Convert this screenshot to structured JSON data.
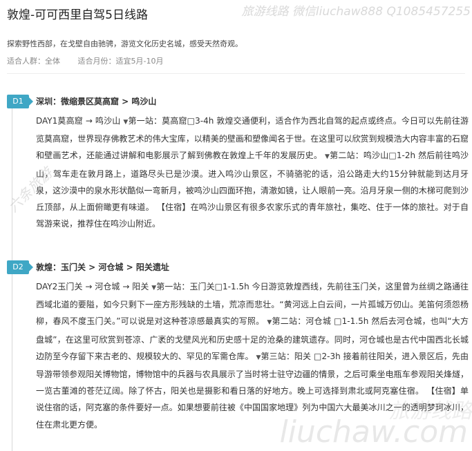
{
  "watermark": {
    "top": "旅游线路 微信liuchaw888 Q1085457255",
    "diagonal": "六条旅游",
    "bottom": "liuchaw.com",
    "bottom_cn": "旅游线路"
  },
  "page": {
    "title": "敦煌-可可西里自驾5日线路",
    "description": "探索野性西部，在戈壁自由驰骋，游览文化历史名城，感受天然奇观。",
    "meta": {
      "crowd": "适合人群：全体",
      "month": "适合月份：适宜5月-10月"
    }
  },
  "days": [
    {
      "badge": "D1",
      "heading": "深圳：微缩景区莫高窟 > 鸣沙山",
      "route": "DAY1莫高窟 → 鸣沙山",
      "stops": [
        "第一站：莫高窟□3-4h 敦煌交通便利，适合作为西北自驾的起点或终点。今日可以先前往游览莫高窟，世界现存佛教艺术的伟大宝库，以精美的壁画和塑像闻名于世。在这里可以欣赏到规模浩大内容丰富的石窟和壁画艺术，还能通过讲解和电影展示了解到佛教在敦煌上千年的发展历史。",
        "第二站：鸣沙山□1-2h 然后前往鸣沙山，驾车走在敦月路上，道路尽头已是沙漠。进入鸣沙山景区，不骑骆驼的话，沿公路走大约15分钟就能到达月牙泉，这沙漠中的泉水形状酷似一弯新月，被鸣沙山四面环抱，清澈如镜，让人眼前一亮。沿月牙泉一侧的木梯可爬到沙丘顶部，从上面俯瞰更有味道。"
      ],
      "stay": "【住宿】在鸣沙山景区有很多农家乐式的青年旅社，集吃、住于一体的旅社。对于自驾游来说，推荐住在鸣沙山附近。"
    },
    {
      "badge": "D2",
      "heading": "敦煌：玉门关 > 河仓城 > 阳关遗址",
      "route": "DAY2玉门关 → 河仓城 → 阳关",
      "stops": [
        "第一站：玉门关□1-1.5h 今日游览敦煌西线，先前往玉门关，这里曾为丝绸之路通往西域北道的要隘，如今只剩下一座方形残缺的土墙，荒凉而悲壮。“黄河远上白云间，一片孤城万仞山。羌笛何须怨杨柳，春风不度玉门关。”可以说是对这种苍凉感最真实的写照。",
        "第二站：河仓城 □1-1.5h 然后去河仓城，也叫“大方盘城”，在这里可欣赏到苍凉、广袤的戈壁风光和历史感十足的沧桑的建筑遗存。同时，河仓城也是古代中国西北长城边防至今存留下来古老的、规模较大的、罕见的军需仓库。",
        "第三站：阳关 □2-3h 接着前往阳关，进入景区后，先由导游带领参观阳关博物馆，博物馆中的兵器与农具展示了当时将士驻守边疆的情景，之后可乘坐电瓶车参观阳关烽燧，一览古董滩的苍茫辽阔。除了怀古，阳关也是摄影和看日落的好地方。晚上可选择到肃北或阿克塞住宿。"
      ],
      "stay": "【住宿】单说住宿的话，阿克塞的条件要好一点。如果想要前往被《中国国家地理》列为中国六大最美冰川之一的透明梦珂冰川，住在肃北更方便。"
    }
  ]
}
